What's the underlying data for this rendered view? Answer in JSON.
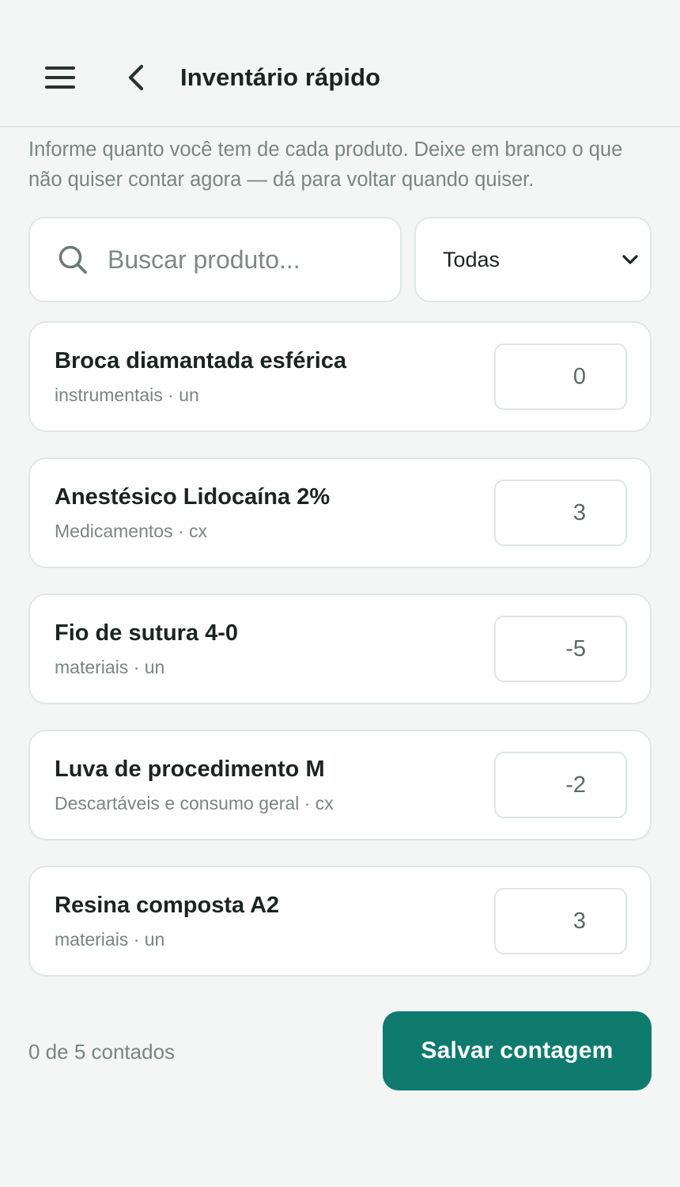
{
  "header": {
    "title": "Inventário rápido",
    "menu_icon": "hamburger-menu-icon",
    "back_icon": "chevron-left-icon"
  },
  "intro": "Informe quanto você tem de cada produto. Deixe em branco o que não quiser contar agora — dá para voltar quando quiser.",
  "search": {
    "placeholder": "Buscar produto...",
    "value": "",
    "icon": "search-icon"
  },
  "category_filter": {
    "selected": "Todas",
    "icon": "chevron-down-icon"
  },
  "items": [
    {
      "name": "Broca diamantada esférica",
      "meta": "instrumentais · un",
      "quantity": "0"
    },
    {
      "name": "Anestésico Lidocaína 2%",
      "meta": "Medicamentos · cx",
      "quantity": "3"
    },
    {
      "name": "Fio de sutura 4-0",
      "meta": "materiais · un",
      "quantity": "-5"
    },
    {
      "name": "Luva de procedimento M",
      "meta": "Descartáveis e consumo geral · cx",
      "quantity": "-2"
    },
    {
      "name": "Resina composta A2",
      "meta": "materiais · un",
      "quantity": "3"
    }
  ],
  "footer": {
    "counter": "0 de 5 contados",
    "save_label": "Salvar contagem"
  },
  "colors": {
    "background": "#f3f6f5",
    "primary": "#0f7b6e",
    "text": "#1c2421",
    "muted": "#7a8582",
    "border": "#dfe6e3"
  }
}
